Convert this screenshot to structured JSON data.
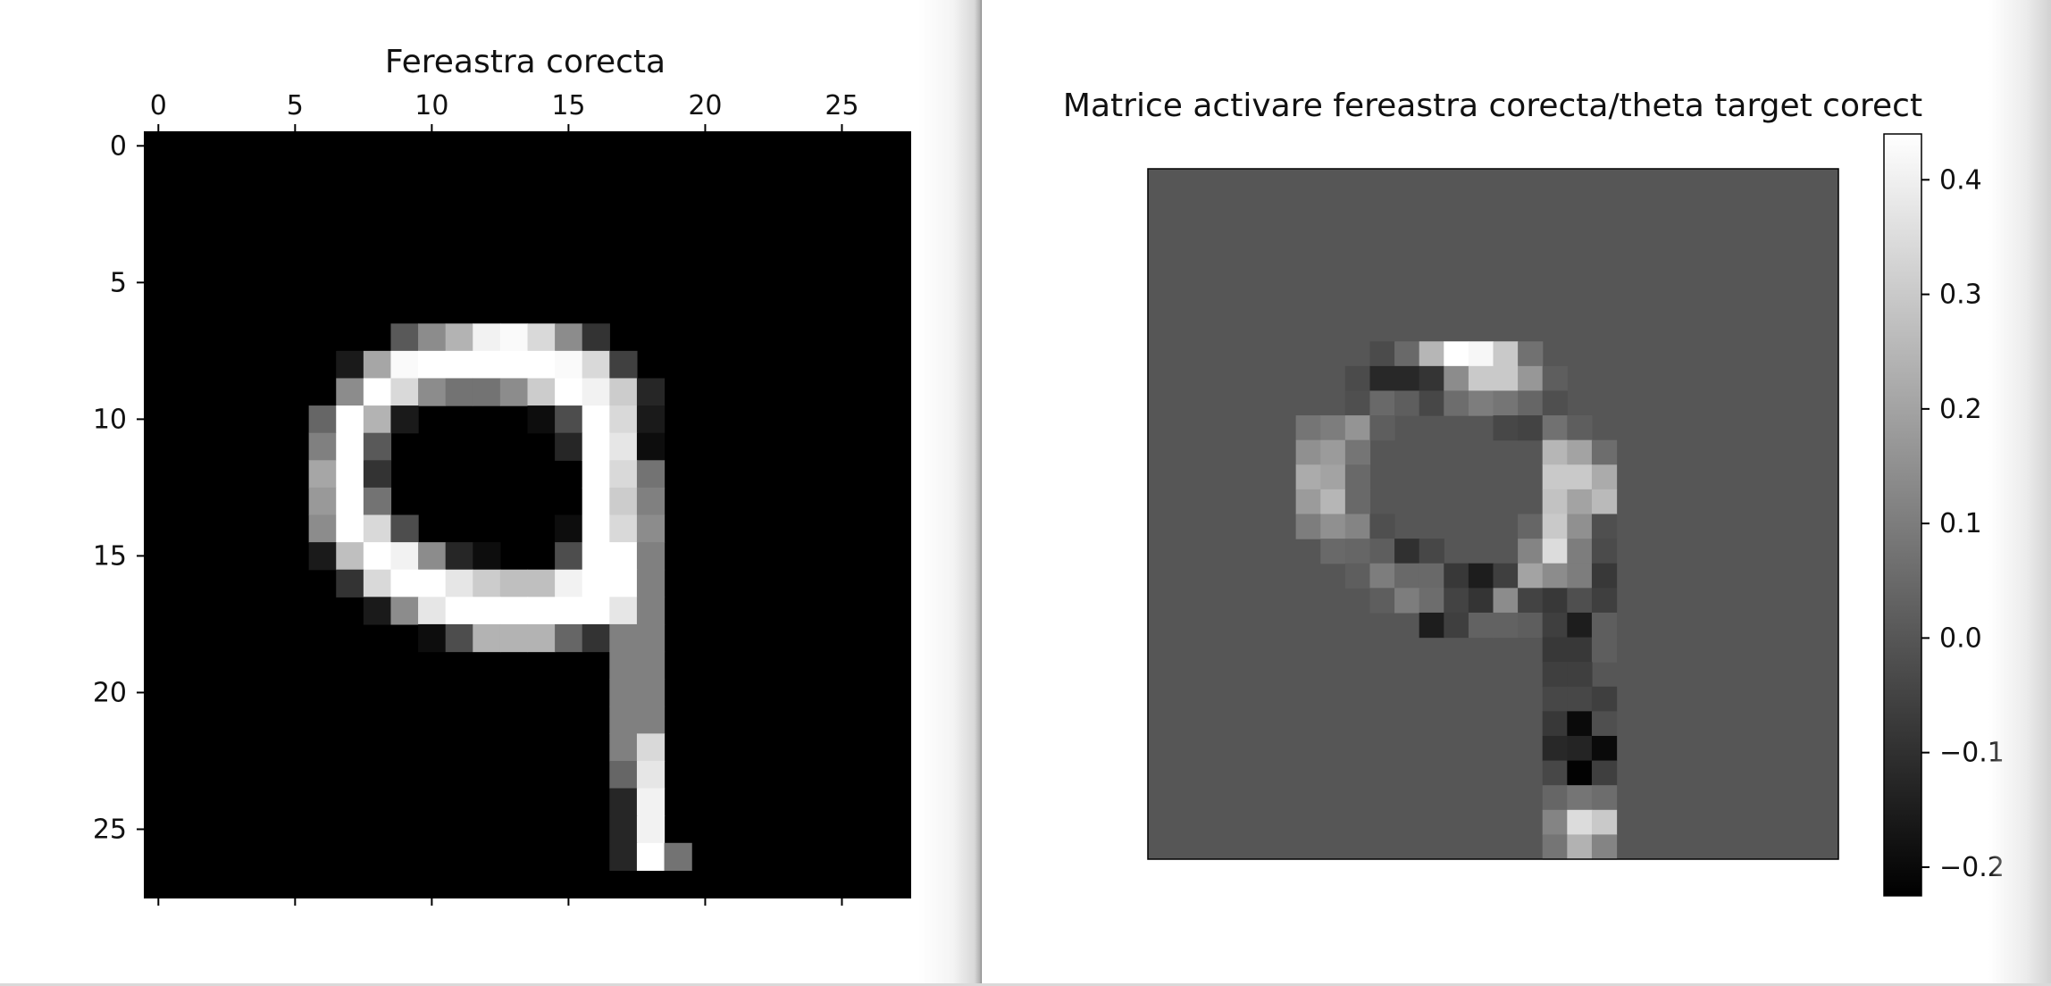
{
  "windows": [
    {
      "id": "left",
      "title": "Fereastra corecta",
      "chart_data": {
        "type": "heatmap",
        "title": "Fereastra corecta",
        "colormap": "gray",
        "x_ticks": [
          "0",
          "5",
          "10",
          "15",
          "20",
          "25"
        ],
        "y_ticks": [
          "0",
          "5",
          "10",
          "15",
          "20",
          "25"
        ],
        "xlim": [
          -0.5,
          27.5
        ],
        "ylim": [
          -0.5,
          27.5
        ],
        "rows": 28,
        "cols": 28,
        "cells": [
          [
            7,
            9,
            0.35
          ],
          [
            7,
            10,
            0.55
          ],
          [
            7,
            11,
            0.7
          ],
          [
            7,
            12,
            0.95
          ],
          [
            7,
            13,
            0.98
          ],
          [
            7,
            14,
            0.85
          ],
          [
            7,
            15,
            0.55
          ],
          [
            7,
            16,
            0.2
          ],
          [
            8,
            7,
            0.1
          ],
          [
            8,
            8,
            0.65
          ],
          [
            8,
            9,
            0.98
          ],
          [
            8,
            10,
            1
          ],
          [
            8,
            11,
            1
          ],
          [
            8,
            12,
            1
          ],
          [
            8,
            13,
            1
          ],
          [
            8,
            14,
            1
          ],
          [
            8,
            15,
            0.98
          ],
          [
            8,
            16,
            0.85
          ],
          [
            8,
            17,
            0.25
          ],
          [
            9,
            7,
            0.55
          ],
          [
            9,
            8,
            1
          ],
          [
            9,
            9,
            0.85
          ],
          [
            9,
            10,
            0.55
          ],
          [
            9,
            11,
            0.45
          ],
          [
            9,
            12,
            0.45
          ],
          [
            9,
            13,
            0.55
          ],
          [
            9,
            14,
            0.8
          ],
          [
            9,
            15,
            1
          ],
          [
            9,
            16,
            0.95
          ],
          [
            9,
            17,
            0.8
          ],
          [
            9,
            18,
            0.15
          ],
          [
            10,
            6,
            0.4
          ],
          [
            10,
            7,
            1
          ],
          [
            10,
            8,
            0.7
          ],
          [
            10,
            9,
            0.1
          ],
          [
            10,
            14,
            0.05
          ],
          [
            10,
            15,
            0.3
          ],
          [
            10,
            16,
            1
          ],
          [
            10,
            17,
            0.85
          ],
          [
            10,
            18,
            0.1
          ],
          [
            11,
            6,
            0.5
          ],
          [
            11,
            7,
            1
          ],
          [
            11,
            8,
            0.35
          ],
          [
            11,
            15,
            0.15
          ],
          [
            11,
            16,
            1
          ],
          [
            11,
            17,
            0.9
          ],
          [
            11,
            18,
            0.05
          ],
          [
            12,
            6,
            0.65
          ],
          [
            12,
            7,
            1
          ],
          [
            12,
            8,
            0.2
          ],
          [
            12,
            16,
            1
          ],
          [
            12,
            17,
            0.85
          ],
          [
            12,
            18,
            0.45
          ],
          [
            13,
            6,
            0.6
          ],
          [
            13,
            7,
            1
          ],
          [
            13,
            8,
            0.45
          ],
          [
            13,
            16,
            1
          ],
          [
            13,
            17,
            0.8
          ],
          [
            13,
            18,
            0.5
          ],
          [
            14,
            6,
            0.55
          ],
          [
            14,
            7,
            1
          ],
          [
            14,
            8,
            0.85
          ],
          [
            14,
            9,
            0.3
          ],
          [
            14,
            15,
            0.05
          ],
          [
            14,
            16,
            1
          ],
          [
            14,
            17,
            0.85
          ],
          [
            14,
            18,
            0.55
          ],
          [
            15,
            6,
            0.1
          ],
          [
            15,
            7,
            0.75
          ],
          [
            15,
            8,
            1
          ],
          [
            15,
            9,
            0.95
          ],
          [
            15,
            10,
            0.55
          ],
          [
            15,
            11,
            0.15
          ],
          [
            15,
            12,
            0.05
          ],
          [
            15,
            15,
            0.3
          ],
          [
            15,
            16,
            1
          ],
          [
            15,
            17,
            1
          ],
          [
            15,
            18,
            0.5
          ],
          [
            16,
            7,
            0.2
          ],
          [
            16,
            8,
            0.85
          ],
          [
            16,
            9,
            1
          ],
          [
            16,
            10,
            1
          ],
          [
            16,
            11,
            0.9
          ],
          [
            16,
            12,
            0.8
          ],
          [
            16,
            13,
            0.75
          ],
          [
            16,
            14,
            0.75
          ],
          [
            16,
            15,
            0.95
          ],
          [
            16,
            16,
            1
          ],
          [
            16,
            17,
            1
          ],
          [
            16,
            18,
            0.5
          ],
          [
            17,
            8,
            0.1
          ],
          [
            17,
            9,
            0.55
          ],
          [
            17,
            10,
            0.9
          ],
          [
            17,
            11,
            1
          ],
          [
            17,
            12,
            1
          ],
          [
            17,
            13,
            1
          ],
          [
            17,
            14,
            1
          ],
          [
            17,
            15,
            1
          ],
          [
            17,
            16,
            1
          ],
          [
            17,
            17,
            0.9
          ],
          [
            17,
            18,
            0.5
          ],
          [
            18,
            10,
            0.05
          ],
          [
            18,
            11,
            0.3
          ],
          [
            18,
            12,
            0.7
          ],
          [
            18,
            13,
            0.7
          ],
          [
            18,
            14,
            0.7
          ],
          [
            18,
            15,
            0.4
          ],
          [
            18,
            16,
            0.2
          ],
          [
            18,
            17,
            0.5
          ],
          [
            18,
            18,
            0.5
          ],
          [
            19,
            17,
            0.5
          ],
          [
            19,
            18,
            0.5
          ],
          [
            20,
            17,
            0.5
          ],
          [
            20,
            18,
            0.5
          ],
          [
            21,
            17,
            0.5
          ],
          [
            21,
            18,
            0.5
          ],
          [
            22,
            17,
            0.5
          ],
          [
            22,
            18,
            0.85
          ],
          [
            23,
            17,
            0.4
          ],
          [
            23,
            18,
            0.9
          ],
          [
            24,
            17,
            0.15
          ],
          [
            24,
            18,
            0.95
          ],
          [
            25,
            17,
            0.15
          ],
          [
            25,
            18,
            0.95
          ],
          [
            26,
            17,
            0.15
          ],
          [
            26,
            18,
            1
          ],
          [
            26,
            19,
            0.45
          ]
        ]
      }
    },
    {
      "id": "right",
      "title": "Matrice activare fereastra corecta/theta target corect",
      "chart_data": {
        "type": "heatmap",
        "title": "Matrice activare fereastra corecta/theta target corect",
        "colormap": "gray",
        "vmin": -0.225,
        "vmax": 0.44,
        "background_value": 0,
        "show_axes": false,
        "colorbar_ticks": [
          "0.4",
          "0.3",
          "0.2",
          "0.1",
          "0.0",
          "−0.1",
          "−0.2"
        ],
        "colorbar_tick_values": [
          0.4,
          0.3,
          0.2,
          0.1,
          0.0,
          -0.1,
          -0.2
        ],
        "rows": 28,
        "cols": 28,
        "cells": [
          [
            7,
            9,
            -0.03
          ],
          [
            7,
            10,
            0.05
          ],
          [
            7,
            11,
            0.25
          ],
          [
            7,
            12,
            0.44
          ],
          [
            7,
            13,
            0.42
          ],
          [
            7,
            14,
            0.3
          ],
          [
            7,
            15,
            0.07
          ],
          [
            8,
            8,
            -0.03
          ],
          [
            8,
            9,
            -0.12
          ],
          [
            8,
            10,
            -0.12
          ],
          [
            8,
            11,
            -0.09
          ],
          [
            8,
            12,
            0.14
          ],
          [
            8,
            13,
            0.3
          ],
          [
            8,
            14,
            0.3
          ],
          [
            8,
            15,
            0.17
          ],
          [
            8,
            16,
            0.02
          ],
          [
            9,
            8,
            -0.02
          ],
          [
            9,
            9,
            0.05
          ],
          [
            9,
            10,
            0.02
          ],
          [
            9,
            11,
            -0.04
          ],
          [
            9,
            12,
            0.06
          ],
          [
            9,
            13,
            0.1
          ],
          [
            9,
            14,
            0.08
          ],
          [
            9,
            15,
            0.04
          ],
          [
            9,
            16,
            -0.02
          ],
          [
            10,
            6,
            0.08
          ],
          [
            10,
            7,
            0.1
          ],
          [
            10,
            8,
            0.16
          ],
          [
            10,
            9,
            0.02
          ],
          [
            10,
            14,
            -0.04
          ],
          [
            10,
            15,
            -0.05
          ],
          [
            10,
            16,
            0.07
          ],
          [
            10,
            17,
            0.02
          ],
          [
            11,
            6,
            0.15
          ],
          [
            11,
            7,
            0.18
          ],
          [
            11,
            8,
            0.08
          ],
          [
            11,
            16,
            0.25
          ],
          [
            11,
            17,
            0.2
          ],
          [
            11,
            18,
            0.06
          ],
          [
            12,
            6,
            0.22
          ],
          [
            12,
            7,
            0.2
          ],
          [
            12,
            8,
            0.05
          ],
          [
            12,
            16,
            0.3
          ],
          [
            12,
            17,
            0.3
          ],
          [
            12,
            18,
            0.22
          ],
          [
            13,
            6,
            0.18
          ],
          [
            13,
            7,
            0.25
          ],
          [
            13,
            8,
            0.05
          ],
          [
            13,
            16,
            0.28
          ],
          [
            13,
            17,
            0.2
          ],
          [
            13,
            18,
            0.26
          ],
          [
            14,
            6,
            0.1
          ],
          [
            14,
            7,
            0.15
          ],
          [
            14,
            8,
            0.12
          ],
          [
            14,
            9,
            -0.02
          ],
          [
            14,
            15,
            0.04
          ],
          [
            14,
            16,
            0.3
          ],
          [
            14,
            17,
            0.15
          ],
          [
            14,
            18,
            -0.02
          ],
          [
            15,
            7,
            0.05
          ],
          [
            15,
            8,
            0.04
          ],
          [
            15,
            9,
            0.02
          ],
          [
            15,
            10,
            -0.1
          ],
          [
            15,
            11,
            -0.04
          ],
          [
            15,
            15,
            0.12
          ],
          [
            15,
            16,
            0.35
          ],
          [
            15,
            17,
            0.1
          ],
          [
            15,
            18,
            -0.03
          ],
          [
            16,
            8,
            0.02
          ],
          [
            16,
            9,
            0.1
          ],
          [
            16,
            10,
            0.05
          ],
          [
            16,
            11,
            0.05
          ],
          [
            16,
            12,
            -0.08
          ],
          [
            16,
            13,
            -0.15
          ],
          [
            16,
            14,
            -0.06
          ],
          [
            16,
            15,
            0.2
          ],
          [
            16,
            16,
            0.14
          ],
          [
            16,
            17,
            0.1
          ],
          [
            16,
            18,
            -0.08
          ],
          [
            17,
            9,
            0.02
          ],
          [
            17,
            10,
            0.1
          ],
          [
            17,
            11,
            0.06
          ],
          [
            17,
            12,
            -0.05
          ],
          [
            17,
            13,
            -0.09
          ],
          [
            17,
            14,
            0.14
          ],
          [
            17,
            15,
            -0.05
          ],
          [
            17,
            16,
            -0.08
          ],
          [
            17,
            17,
            -0.02
          ],
          [
            17,
            18,
            -0.06
          ],
          [
            18,
            11,
            -0.15
          ],
          [
            18,
            12,
            -0.06
          ],
          [
            18,
            13,
            0.03
          ],
          [
            18,
            14,
            0.03
          ],
          [
            18,
            15,
            0.02
          ],
          [
            18,
            16,
            -0.06
          ],
          [
            18,
            17,
            -0.15
          ],
          [
            18,
            18,
            0.02
          ],
          [
            19,
            16,
            -0.08
          ],
          [
            19,
            17,
            -0.08
          ],
          [
            19,
            18,
            0.02
          ],
          [
            20,
            16,
            -0.06
          ],
          [
            20,
            17,
            -0.06
          ],
          [
            21,
            16,
            -0.04
          ],
          [
            21,
            17,
            -0.04
          ],
          [
            21,
            18,
            -0.06
          ],
          [
            22,
            16,
            -0.08
          ],
          [
            22,
            17,
            -0.2
          ],
          [
            22,
            18,
            -0.02
          ],
          [
            23,
            16,
            -0.12
          ],
          [
            23,
            17,
            -0.13
          ],
          [
            23,
            18,
            -0.2
          ],
          [
            24,
            16,
            -0.04
          ],
          [
            24,
            17,
            -0.22
          ],
          [
            24,
            18,
            -0.06
          ],
          [
            25,
            16,
            0.04
          ],
          [
            25,
            17,
            0.08
          ],
          [
            25,
            18,
            0.06
          ],
          [
            26,
            16,
            0.12
          ],
          [
            26,
            17,
            0.35
          ],
          [
            26,
            18,
            0.3
          ],
          [
            27,
            16,
            0.08
          ],
          [
            27,
            17,
            0.24
          ],
          [
            27,
            18,
            0.12
          ]
        ]
      }
    }
  ]
}
